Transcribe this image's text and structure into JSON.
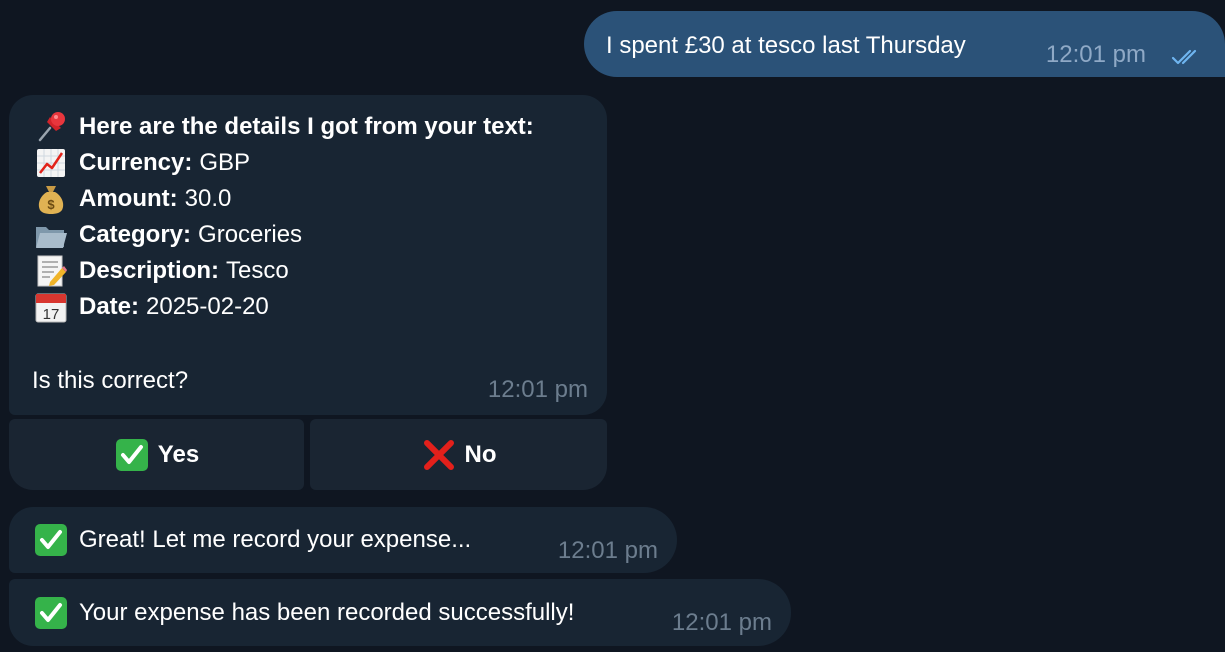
{
  "outgoing": {
    "text": "I spent £30 at tesco last Thursday",
    "time": "12:01 pm",
    "status_icon": "double-check-icon"
  },
  "details_message": {
    "header": "Here are the details I got from your text:",
    "fields": [
      {
        "label": "Currency:",
        "value": "GBP",
        "icon": "chart-increasing-icon"
      },
      {
        "label": "Amount:",
        "value": "30.0",
        "icon": "money-bag-icon"
      },
      {
        "label": "Category:",
        "value": "Groceries",
        "icon": "folder-icon"
      },
      {
        "label": "Description:",
        "value": "Tesco",
        "icon": "memo-icon"
      },
      {
        "label": "Date:",
        "value": "2025-02-20",
        "icon": "calendar-icon"
      }
    ],
    "question": "Is this correct?",
    "time": "12:01 pm"
  },
  "keyboard": {
    "yes_label": "Yes",
    "no_label": "No"
  },
  "messages": [
    {
      "text": "Great! Let me record your expense...",
      "time": "12:01 pm"
    },
    {
      "text": "Your expense has been recorded successfully!",
      "time": "12:01 pm"
    }
  ],
  "colors": {
    "background": "#0f1621",
    "outgoing_bubble": "#2b5278",
    "incoming_bubble": "#182533",
    "check_green": "#35b34a",
    "cross_red": "#e3201b"
  }
}
